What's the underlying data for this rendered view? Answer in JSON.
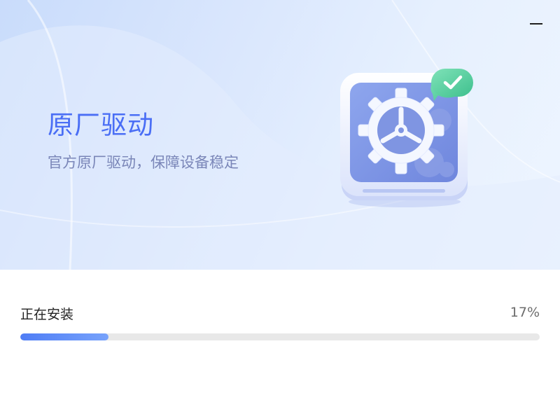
{
  "window": {
    "minimize_label": "minimize"
  },
  "hero": {
    "title": "原厂驱动",
    "subtitle": "官方原厂驱动，保障设备稳定",
    "icon": "driver-gear-icon",
    "badge_icon": "checkmark-icon"
  },
  "install": {
    "status_label": "正在安装",
    "progress_text": "17%",
    "progress_fraction": 0.17
  },
  "colors": {
    "accent": "#4a6ef5",
    "progress_fill": "#4f7df5",
    "progress_track": "#e8e8e8",
    "badge_green": "#5fd3a6"
  }
}
